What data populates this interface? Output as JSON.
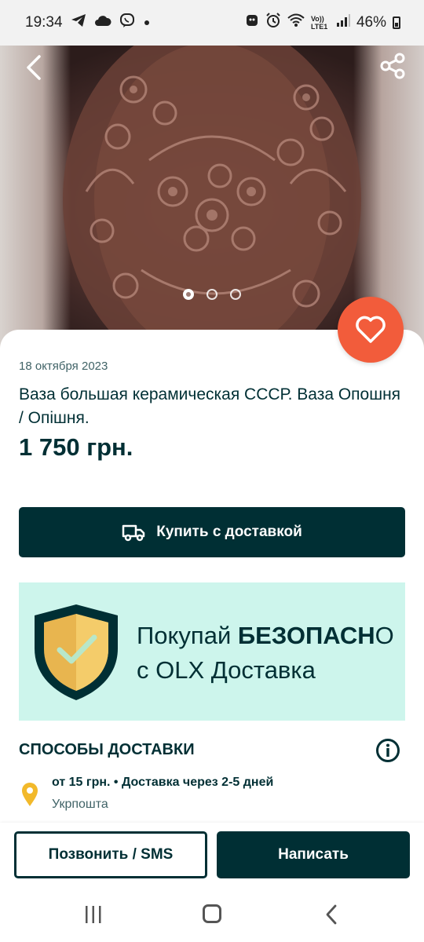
{
  "status_bar": {
    "time": "19:34",
    "volte_label": "Vo)) LTE1",
    "battery": "46%",
    "left_icons": [
      "telegram-icon",
      "cloud-icon",
      "viber-icon",
      "notification-dot-icon"
    ],
    "right_icons": [
      "app-notification-icon",
      "alarm-icon",
      "wifi-icon",
      "signal-icon",
      "battery-icon"
    ]
  },
  "gallery": {
    "image_count": 3,
    "active_index": 0
  },
  "listing": {
    "date": "18 октября 2023",
    "title": "Ваза большая керамическая СССР. Ваза Опошня / Опішня.",
    "price": "1 750 грн."
  },
  "buy_button": {
    "label": "Купить с доставкой",
    "icon": "truck-icon"
  },
  "banner": {
    "line1_plain": "Покупай ",
    "line1_bold": "БЕЗОПАСН",
    "line1_tail": "О",
    "line2": "с OLX Доставка"
  },
  "delivery": {
    "section_title": "СПОСОБЫ ДОСТАВКИ",
    "price_and_time": "от 15 грн. • Доставка через 2-5 дней",
    "carrier": "Укрпошта"
  },
  "actions": {
    "call_label": "Позвонить / SMS",
    "write_label": "Написать"
  },
  "colors": {
    "primary": "#002f34",
    "accent": "#f25c3b",
    "banner_bg": "#cdf5ec",
    "pin": "#f2b92b",
    "shield_gold": "#e8b54f"
  }
}
